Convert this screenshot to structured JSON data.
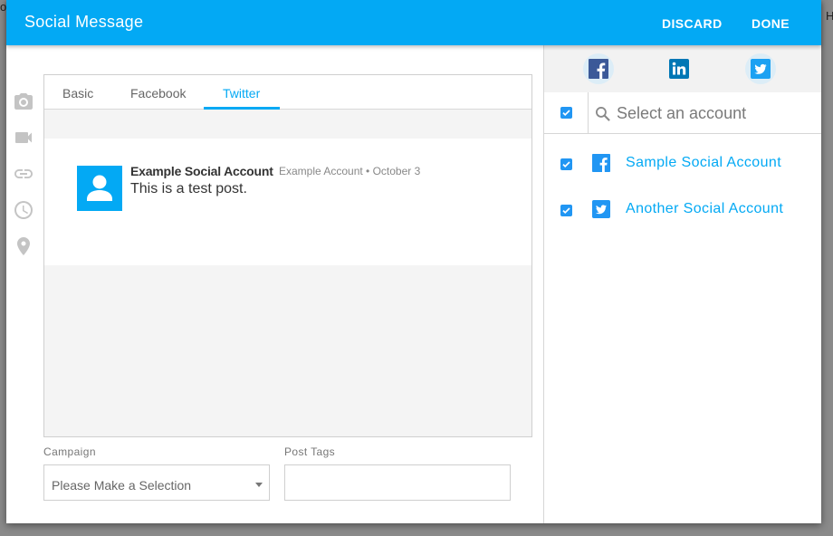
{
  "app": {
    "title": "Social Message",
    "actions": {
      "discard": "DISCARD",
      "done": "DONE"
    },
    "background_fragments": {
      "left": "o",
      "right": "H"
    }
  },
  "toolbar_icons": [
    "camera-icon",
    "video-icon",
    "link-icon",
    "clock-icon",
    "location-pin-icon"
  ],
  "editor": {
    "tabs": [
      {
        "label": "Basic",
        "active": false
      },
      {
        "label": "Facebook",
        "active": false
      },
      {
        "label": "Twitter",
        "active": true
      }
    ],
    "preview": {
      "account_name": "Example Social Account",
      "meta": "Example Account • October 3",
      "text": "This is a test post."
    }
  },
  "form": {
    "campaign": {
      "label": "Campaign",
      "value": "Please Make a Selection"
    },
    "post_tags": {
      "label": "Post Tags",
      "value": ""
    }
  },
  "accounts_panel": {
    "networks": [
      {
        "name": "facebook",
        "icon": "facebook-icon",
        "selected": true
      },
      {
        "name": "linkedin",
        "icon": "linkedin-icon",
        "selected": false
      },
      {
        "name": "twitter",
        "icon": "twitter-icon",
        "selected": true
      }
    ],
    "search": {
      "placeholder": "Select an account",
      "value": "",
      "select_all": true
    },
    "accounts": [
      {
        "name": "Sample Social Account",
        "network": "facebook",
        "checked": true
      },
      {
        "name": "Another Social Account",
        "network": "twitter",
        "checked": true
      }
    ]
  },
  "colors": {
    "primary": "#03a9f4",
    "checkbox": "#2196f3",
    "facebook": "#3b5998",
    "linkedin": "#0077b5",
    "twitter": "#1da1f2"
  }
}
